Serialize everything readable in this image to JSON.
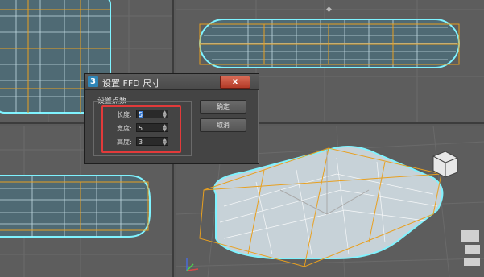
{
  "dialog": {
    "icon_text": "3",
    "title": "设置 FFD 尺寸",
    "close_label": "x",
    "group_label": "设置点数",
    "fields": [
      {
        "label": "长度:",
        "value": "5"
      },
      {
        "label": "宽度:",
        "value": "5"
      },
      {
        "label": "高度:",
        "value": "3"
      }
    ],
    "ok_label": "确定",
    "cancel_label": "取消"
  },
  "colors": {
    "viewport_bg": "#5d5d5d",
    "lattice_orange": "#e8a020",
    "selection_cyan": "#7ff3ff",
    "highlight_red": "#e23a3a"
  }
}
